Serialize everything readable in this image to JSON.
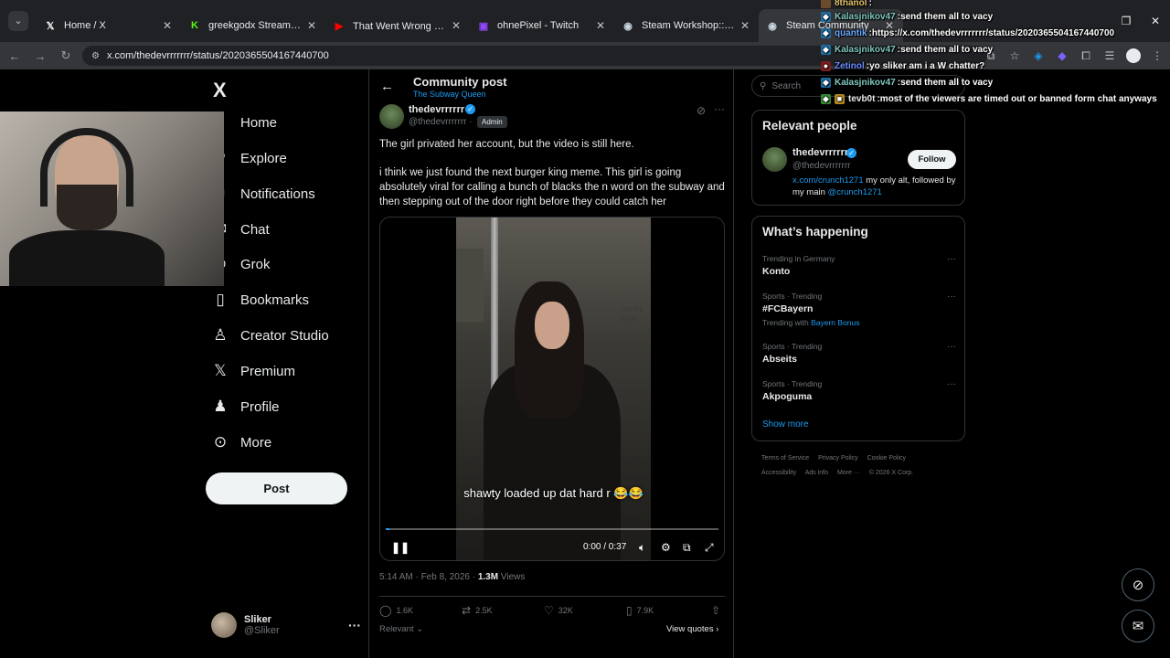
{
  "browser": {
    "tabs": [
      {
        "favicon": "x-logo-icon",
        "title": "Home / X",
        "active": false
      },
      {
        "favicon": "kick-icon",
        "title": "greekgodx Stream - Watch Live",
        "active": false
      },
      {
        "favicon": "youtube-icon",
        "title": "That Went Wrong Real Quick 🔒",
        "active": false
      },
      {
        "favicon": "twitch-icon",
        "title": "ohnePixel - Twitch",
        "active": false
      },
      {
        "favicon": "steam-icon",
        "title": "Steam Workshop::Black Ops 3 C",
        "active": false
      },
      {
        "favicon": "steam-icon",
        "title": "Steam Community",
        "active": false
      }
    ],
    "url": "x.com/thedevrrrrrrr/status/2020365504167440700"
  },
  "nav": {
    "logo": "X",
    "items": [
      {
        "icon": "home-icon",
        "label": "Home"
      },
      {
        "icon": "explore-icon",
        "label": "Explore"
      },
      {
        "icon": "bell-icon",
        "label": "Notifications"
      },
      {
        "icon": "chat-icon",
        "label": "Chat"
      },
      {
        "icon": "grok-icon",
        "label": "Grok"
      },
      {
        "icon": "bookmark-icon",
        "label": "Bookmarks"
      },
      {
        "icon": "creator-studio-icon",
        "label": "Creator Studio"
      },
      {
        "icon": "premium-icon",
        "label": "Premium"
      },
      {
        "icon": "profile-icon",
        "label": "Profile"
      },
      {
        "icon": "more-icon",
        "label": "More"
      }
    ],
    "post_label": "Post",
    "account": {
      "name": "Sliker",
      "handle": "@Sliker"
    }
  },
  "main": {
    "header_title": "Community post",
    "header_sub": "The Subway Queen",
    "author": {
      "name": "thedevrrrrrr",
      "handle": "@thedevrrrrrrr ·",
      "role": "Admin"
    },
    "text1": "The girl privated her account, but the video is still here.",
    "text2": "i think we just found the next burger king meme. This girl is going absolutely viral for calling a bunch of blacks the n word on the subway and then stepping out of the door right before they could catch her",
    "video": {
      "caption": "shawty loaded up dat hard r 😂😂",
      "time": "0:00 / 0:37",
      "progress": 0.01,
      "sign_text": "Don't b subw"
    },
    "timestamp": "5:14 AM · Feb 8, 2026 · ",
    "views_count": "1.3M",
    "views_label": " Views",
    "actions": {
      "replies": "1.6K",
      "reposts": "2.5K",
      "likes": "32K",
      "bookmarks": "7.9K"
    },
    "sort_label": "Relevant ⌄",
    "view_quotes": "View quotes ›"
  },
  "right": {
    "search_placeholder": "Search",
    "relevant_title": "Relevant people",
    "person": {
      "name": "thedevrrrrrr",
      "handle": "@thedevrrrrrrr",
      "follow": "Follow",
      "bio_link": "x.com/crunch1271",
      "bio_mid": " my only alt, followed by my main ",
      "bio_mention": "@crunch1271"
    },
    "happening_title": "What’s happening",
    "trends": [
      {
        "category": "Trending in Germany",
        "name": "Konto",
        "with_label": "",
        "with_link": ""
      },
      {
        "category": "Sports · Trending",
        "name": "#FCBayern",
        "with_label": "Trending with ",
        "with_link": "Bayern Bonus"
      },
      {
        "category": "Sports · Trending",
        "name": "Abseits",
        "with_label": "",
        "with_link": ""
      },
      {
        "category": "Sports · Trending",
        "name": "Akpoguma",
        "with_label": "",
        "with_link": ""
      }
    ],
    "show_more": "Show more",
    "footer": [
      "Terms of Service",
      "Privacy Policy",
      "Cookie Policy",
      "Accessibility",
      "Ads info",
      "More ···",
      "© 2026 X Corp."
    ]
  },
  "chat": [
    {
      "user": "8thanol",
      "color": "#e3c36a",
      "message": ""
    },
    {
      "user": "Kalasjnikov47",
      "color": "#7ec8c0",
      "message": "send them all to vacy"
    },
    {
      "user": "quantik",
      "color": "#6aa8ff",
      "message": "https://x.com/thedevrrrrrrr/status/2020365504167440700"
    },
    {
      "user": "Kalasjnikov47",
      "color": "#7ec8c0",
      "message": "send them all to vacy"
    },
    {
      "user": "Zetinol",
      "color": "#6a8cff",
      "message": "yo sliker am i a W chatter?"
    },
    {
      "user": "Kalasjnikov47",
      "color": "#7ec8c0",
      "message": "send them all to vacy"
    },
    {
      "user": "tevb0t",
      "color": "#e7e9ea",
      "message": "most of the viewers are timed out or banned form chat anyways"
    }
  ],
  "colors": {
    "accent": "#1d9bf0",
    "background": "#000000",
    "border": "#2f3336"
  }
}
